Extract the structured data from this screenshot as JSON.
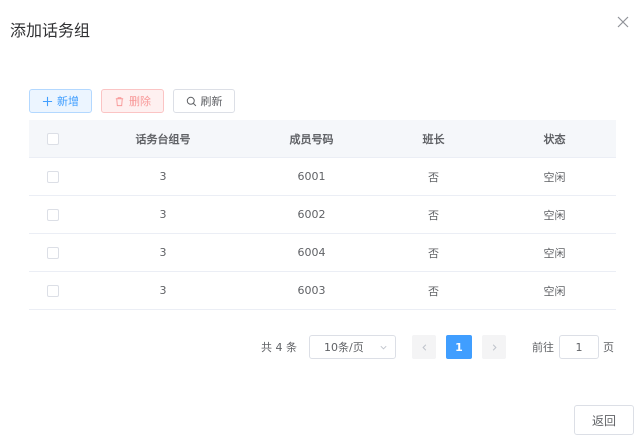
{
  "dialog": {
    "title": "添加话务组"
  },
  "toolbar": {
    "add_label": "新增",
    "delete_label": "删除",
    "refresh_label": "刷新"
  },
  "table": {
    "columns": [
      "话务台组号",
      "成员号码",
      "班长",
      "状态"
    ],
    "rows": [
      {
        "group": "3",
        "member": "6001",
        "leader": "否",
        "status": "空闲"
      },
      {
        "group": "3",
        "member": "6002",
        "leader": "否",
        "status": "空闲"
      },
      {
        "group": "3",
        "member": "6004",
        "leader": "否",
        "status": "空闲"
      },
      {
        "group": "3",
        "member": "6003",
        "leader": "否",
        "status": "空闲"
      }
    ]
  },
  "pagination": {
    "total": "共 4 条",
    "page_size": "10条/页",
    "current_page": "1",
    "jump_label": "前往",
    "jump_value": "1",
    "jump_suffix": "页"
  },
  "footer": {
    "back_label": "返回"
  },
  "colors": {
    "primary": "#409eff",
    "danger_text": "#f89898",
    "border": "#dcdfe6"
  }
}
